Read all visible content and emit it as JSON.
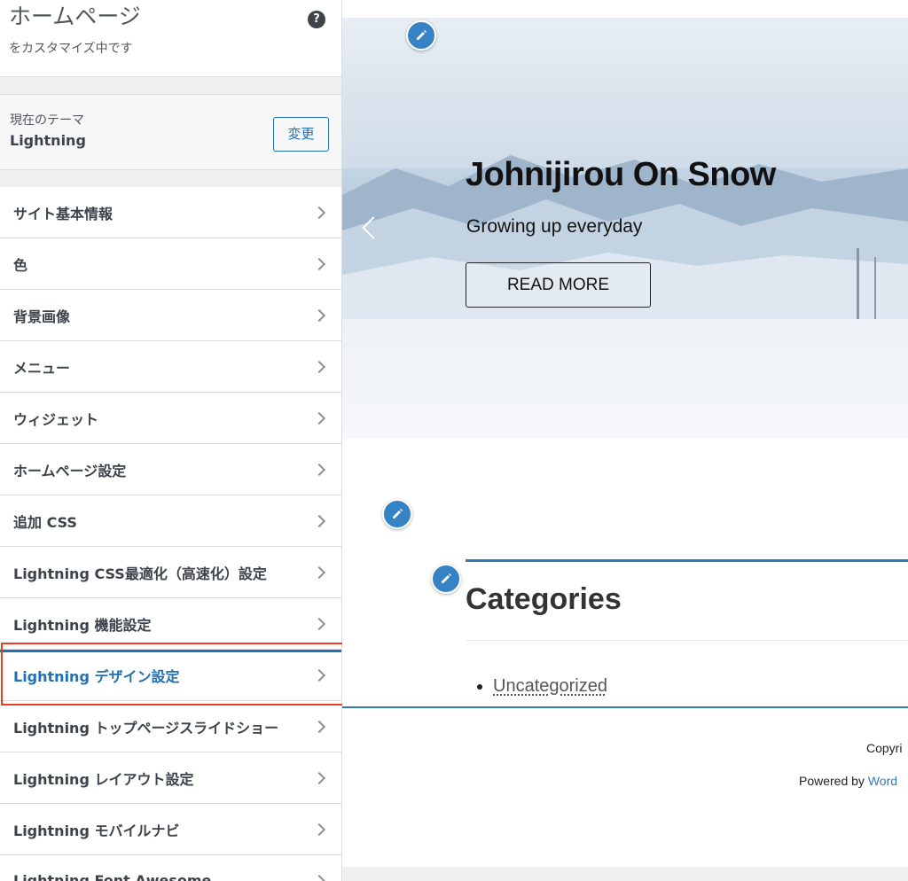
{
  "sidebar": {
    "title": "ホームページ",
    "subtitle": "をカスタマイズ中です",
    "help_icon": "?",
    "theme": {
      "label": "現在のテーマ",
      "name": "Lightning",
      "change_label": "変更"
    },
    "items": [
      {
        "label": "サイト基本情報"
      },
      {
        "label": "色"
      },
      {
        "label": "背景画像"
      },
      {
        "label": "メニュー"
      },
      {
        "label": "ウィジェット"
      },
      {
        "label": "ホームページ設定"
      },
      {
        "label": "追加 CSS"
      },
      {
        "label": "Lightning CSS最適化（高速化）設定"
      },
      {
        "label": "Lightning 機能設定"
      },
      {
        "label": "Lightning デザイン設定",
        "active": true
      },
      {
        "label": "Lightning トップページスライドショー"
      },
      {
        "label": "Lightning レイアウト設定"
      },
      {
        "label": "Lightning モバイルナビ"
      },
      {
        "label": "Lightning Font Awesome"
      }
    ]
  },
  "preview": {
    "hero": {
      "title": "Johnijirou On Snow",
      "subtitle": "Growing up everyday",
      "button_label": "READ MORE"
    },
    "widget": {
      "title": "Categories",
      "items": [
        "Uncategorized"
      ]
    },
    "footer": {
      "copyright": "Copyri",
      "powered_prefix": "Powered by ",
      "powered_link": "Word"
    }
  },
  "colors": {
    "accent": "#2271b1",
    "highlight": "#e8401c",
    "theme_blue": "#337ab7"
  }
}
